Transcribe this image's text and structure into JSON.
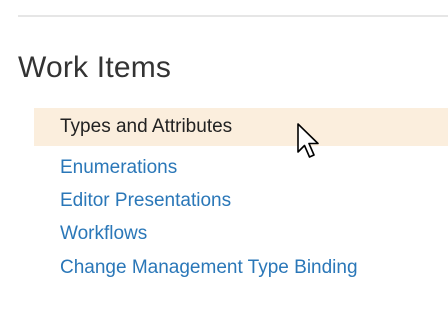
{
  "section": {
    "heading": "Work Items",
    "items": [
      {
        "label": "Types and Attributes",
        "selected": true
      },
      {
        "label": "Enumerations",
        "selected": false
      },
      {
        "label": "Editor Presentations",
        "selected": false
      },
      {
        "label": "Workflows",
        "selected": false
      },
      {
        "label": "Change Management Type Binding",
        "selected": false
      }
    ]
  },
  "colors": {
    "link": "#2a77b8",
    "selected_background": "#fbeedd",
    "heading": "#333333"
  },
  "icons": {
    "pointer": "mouse-pointer-icon"
  }
}
